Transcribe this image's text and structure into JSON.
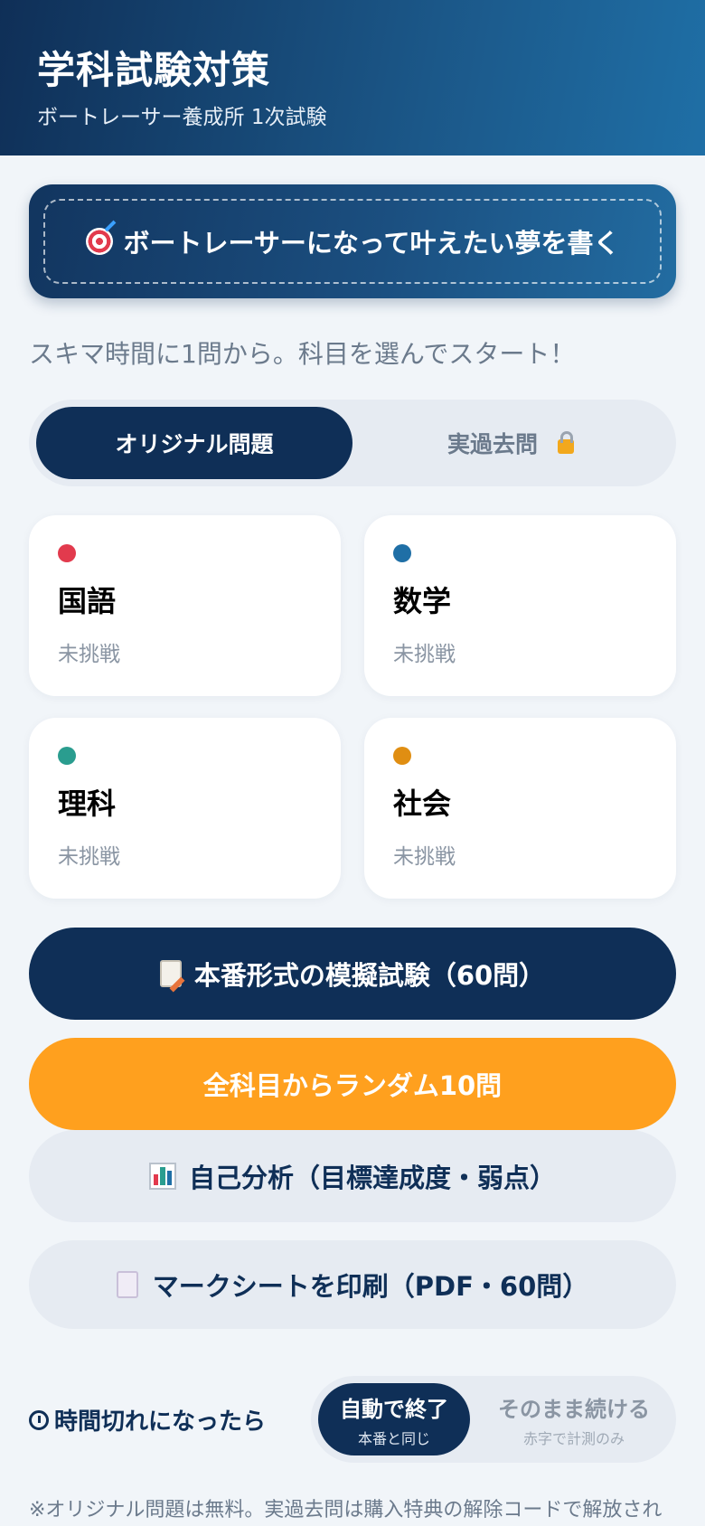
{
  "header": {
    "title": "学科試験対策",
    "subtitle": "ボートレーサー養成所 1次試験"
  },
  "dream_button": {
    "icon": "dart-target-icon",
    "label": "ボートレーサーになって叶えたい夢を書く"
  },
  "tagline": "スキマ時間に1問から。科目を選んでスタート！",
  "tabs": [
    {
      "label": "オリジナル問題",
      "active": true
    },
    {
      "label": "実過去問",
      "active": false,
      "icon": "lock-icon"
    }
  ],
  "subjects": [
    {
      "name": "国語",
      "status": "未挑戦",
      "color": "#e23a4d"
    },
    {
      "name": "数学",
      "status": "未挑戦",
      "color": "#1f6fa6"
    },
    {
      "name": "理科",
      "status": "未挑戦",
      "color": "#2a9d8f"
    },
    {
      "name": "社会",
      "status": "未挑戦",
      "color": "#e08e12"
    }
  ],
  "actions": {
    "mock_exam": "本番形式の模擬試験（60問）",
    "random": "全科目からランダム10問",
    "analysis": "自己分析（目標達成度・弱点）",
    "print": "マークシートを印刷（PDF・60問）"
  },
  "timeout": {
    "label": "時間切れになったら",
    "options": [
      {
        "label": "自動で終了",
        "sub": "本番と同じ",
        "selected": true
      },
      {
        "label": "そのまま続ける",
        "sub": "赤字で計測のみ",
        "selected": false
      }
    ]
  },
  "footnote": "※オリジナル問題は無料。実過去問は購入特典の解除コードで解放され",
  "colors": {
    "navy": "#0f2f57",
    "orange": "#ffa01e",
    "background": "#f1f5f9"
  }
}
